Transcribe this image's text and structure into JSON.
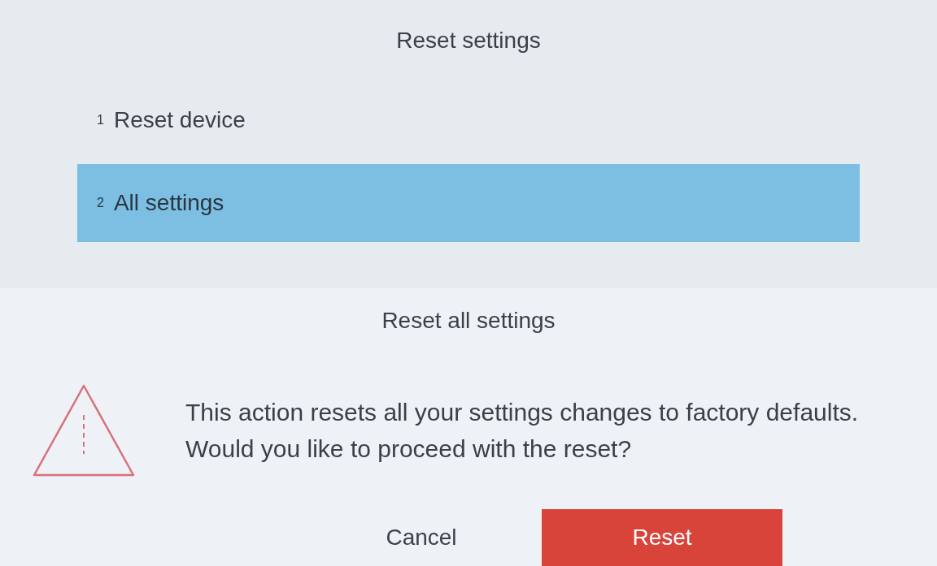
{
  "screen": {
    "title": "Reset settings"
  },
  "items": [
    {
      "number": "1",
      "label": "Reset device",
      "selected": false
    },
    {
      "number": "2",
      "label": "All settings",
      "selected": true
    }
  ],
  "dialog": {
    "title": "Reset all settings",
    "message": "This action resets all your settings changes to factory defaults. Would you like to proceed with the reset?",
    "buttons": [
      {
        "label": "Cancel",
        "kind": "secondary"
      },
      {
        "label": "Reset",
        "kind": "danger"
      }
    ]
  }
}
